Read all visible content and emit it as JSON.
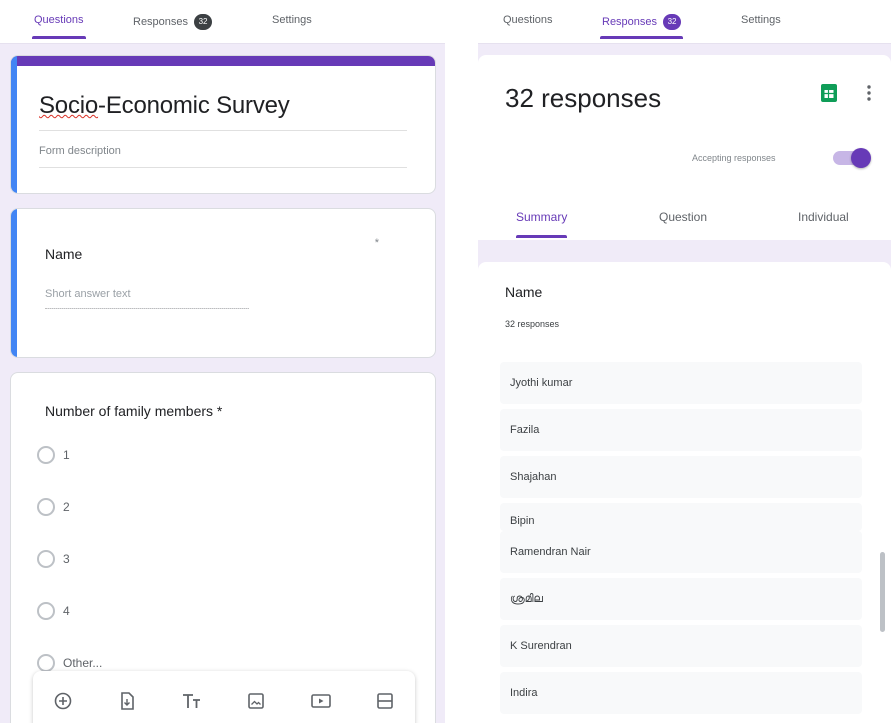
{
  "editor": {
    "tabs": [
      {
        "label": "Questions",
        "active": true
      },
      {
        "label": "Responses",
        "badge": "32"
      },
      {
        "label": "Settings"
      }
    ],
    "form": {
      "title_part1": "Socio",
      "title_part2": "-Economic Survey",
      "description": "Form description"
    },
    "name_question": {
      "label": "Name",
      "required_mark": "*",
      "placeholder": "Short answer text"
    },
    "family_question": {
      "label": "Number of family members *",
      "options": [
        "1",
        "2",
        "3",
        "4",
        "Other..."
      ]
    },
    "toolbar": {
      "icons": [
        "add-question-icon",
        "import-questions-icon",
        "add-title-icon",
        "add-image-icon",
        "add-video-icon",
        "add-section-icon"
      ]
    }
  },
  "responses_view": {
    "tabs": [
      {
        "label": "Questions"
      },
      {
        "label": "Responses",
        "badge": "32",
        "active": true
      },
      {
        "label": "Settings"
      }
    ],
    "count_title": "32 responses",
    "accepting_label": "Accepting responses",
    "accepting": true,
    "sub_tabs": [
      {
        "label": "Summary",
        "active": true
      },
      {
        "label": "Question"
      },
      {
        "label": "Individual"
      }
    ],
    "summary": {
      "question": "Name",
      "count_text": "32 responses",
      "answers": [
        "Jyothi kumar",
        "Fazila",
        "Shajahan",
        "Bipin",
        "Ramendran Nair",
        "ശ്രമില",
        "K Surendran",
        "Indira"
      ]
    }
  },
  "colors": {
    "accent": "#673ab7",
    "question_accent": "#4285f4",
    "background": "#f0ebf8",
    "sheets_green": "#0f9d58"
  }
}
